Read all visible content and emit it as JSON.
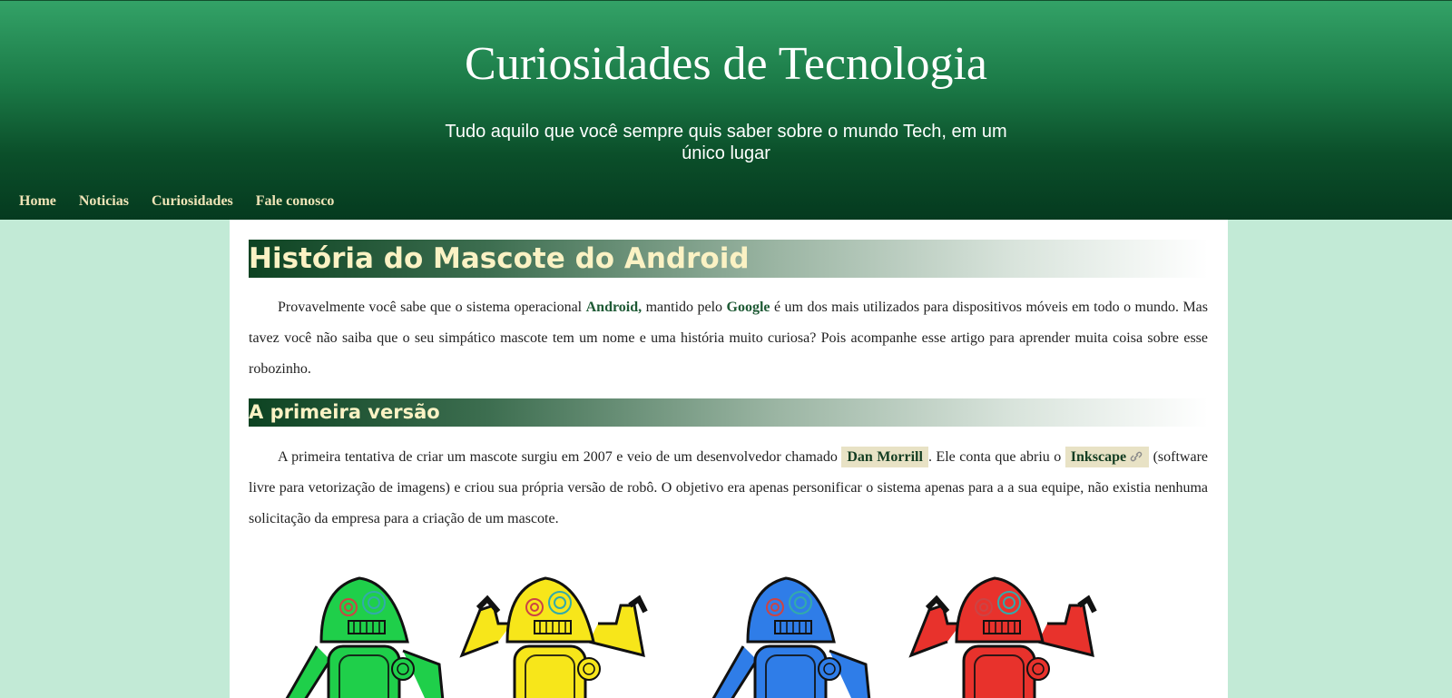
{
  "header": {
    "title": "Curiosidades de Tecnologia",
    "subtitle": "Tudo aquilo que você sempre quis saber sobre o mundo Tech, em um único lugar"
  },
  "nav": {
    "items": [
      "Home",
      "Noticias",
      "Curiosidades",
      "Fale conosco"
    ]
  },
  "article": {
    "title": "História do Mascote do Android",
    "intro": {
      "t1": "Provavelmente você sabe que o sistema operacional ",
      "android": "Android,",
      "t2": " mantido pelo ",
      "google": "Google",
      "t3": " é um dos mais utilizados para dispositivos móveis em todo o mundo. Mas tavez você não saiba que o seu simpático mascote tem um nome e uma história muito curiosa? Pois acompanhe esse artigo para aprender muita coisa sobre esse robozinho."
    },
    "section1": {
      "heading": "A primeira versão",
      "t1": "A primeira tentativa de criar um mascote surgiu em 2007 e veio de um desenvolvedor chamado ",
      "dan": "Dan Morrill",
      "t2": ". Ele conta que abriu o ",
      "inkscape": "Inkscape",
      "t3": " (software livre para vetorização de imagens) e criou sua própria versão de robô. O objetivo era apenas personificar o sistema apenas para a a sua equipe, não existia nenhuma solicitação da empresa para a criação de um mascote."
    },
    "robot_colors": [
      "#1fcf4a",
      "#f7e61a",
      "#2f7de8",
      "#e8322c"
    ]
  },
  "colors": {
    "page_bg": "#c2ead6",
    "header_dark": "#053a1f",
    "nav_text": "#efe4b7",
    "heading_text": "#fbf2c4",
    "highlight_bg": "#e8e2c5"
  }
}
